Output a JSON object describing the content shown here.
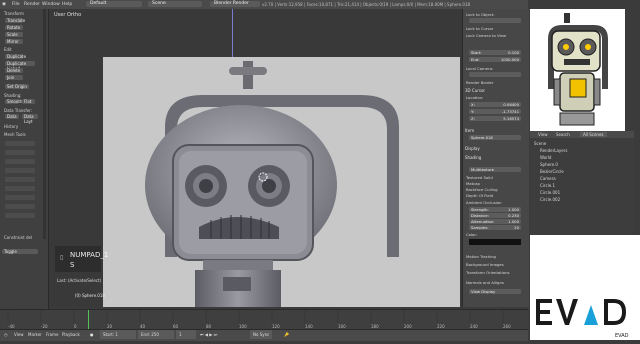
{
  "topbar": {
    "menu": [
      "File",
      "Render",
      "Window",
      "Help"
    ],
    "layout": "Default",
    "scene": "Scene",
    "engine": "Blender Render",
    "info": "v2.70 | Verts:12,958 | Faces:10,871 | Tris:21,414 | Objects:0/19 | Lamps:0/0 | Mem:18.00M | Sphere.018"
  },
  "toolshelf": {
    "transform_header": "Transform",
    "translate": "Translate",
    "rotate": "Rotate",
    "scale": "Scale",
    "mirror": "Mirror",
    "edit_header": "Edit",
    "duplicate": "Duplicate",
    "duplicate_linked": "Duplicate Linked",
    "delete": "Delete",
    "join": "Join",
    "set_origin": "Set Origin",
    "shading": "Shading:",
    "smooth": "Smooth",
    "flat": "Flat",
    "data_transfer": "Data Transfer:",
    "data": "Data",
    "data_layout": "Data Layt",
    "history": "History",
    "mesh_tools": "Mesh Tools",
    "last_op": "Constraint del",
    "toggle": "Toggle"
  },
  "viewport": {
    "view_label": "User Ortho",
    "numpad_label": "NUMPAD_1",
    "numpad_sub": "S",
    "last_op": "Last: (Activate/Select)",
    "object_name": "(0) Sphere.018",
    "header_mode": "Object Mode",
    "header_global": "Global"
  },
  "properties": {
    "lock_to_object": "Lock to Object:",
    "lock_to_cursor": "Lock to Cursor",
    "lock_camera": "Lock Camera to View",
    "clip_start_label": "Start:",
    "clip_start": "0.100",
    "clip_end_label": "End:",
    "clip_end": "1000.000",
    "local_camera": "Local Camera:",
    "render_border": "Render Border",
    "cursor_header": "3D Cursor",
    "location": "Location:",
    "x": "0.06400",
    "y": "-1.73741",
    "z": "5.16574",
    "item_header": "Item",
    "item_name": "Sphere.018",
    "display_header": "Display",
    "shading_header": "Shading",
    "multitexture": "Multitexture",
    "textured_solid": "Textured Solid",
    "matcap": "Matcap",
    "backface_culling": "Backface Culling",
    "depth_of_field": "Depth Of Field",
    "ambient_occlusion": "Ambient Occlusion",
    "strength_label": "Strength:",
    "strength": "1.000",
    "distance_label": "Distance:",
    "distance": "0.230",
    "attenuation_label": "Attenuation:",
    "attenuation": "1.000",
    "samples_label": "Samples:",
    "samples": "20",
    "color_label": "Color:",
    "motion_tracking": "Motion Tracking",
    "background_images": "Background Images",
    "transform_orientations": "Transform Orientations",
    "normals": "Normals and Alligns",
    "view_display": "View Display"
  },
  "outliner": {
    "tabs": [
      "View",
      "Search",
      "All Scenes"
    ],
    "items": [
      "Scene",
      "RenderLayers",
      "World",
      "Sphere.0",
      "BezierCircle",
      "Camera",
      "Circle.1",
      "Circle.001",
      "Circle.002"
    ]
  },
  "timeline": {
    "menus": [
      "View",
      "Marker",
      "Frame",
      "Playback"
    ],
    "start_label": "Start:",
    "start": "1",
    "end_label": "End:",
    "end": "250",
    "current": "1",
    "sync": "No Sync",
    "ruler": [
      "-40",
      "-20",
      "0",
      "20",
      "40",
      "60",
      "80",
      "100",
      "120",
      "140",
      "160",
      "180",
      "200",
      "220",
      "240",
      "260"
    ]
  },
  "brand": {
    "logo": "EVAD",
    "sub": "EVAD"
  },
  "colors": {
    "accent": "#5680c2",
    "panel": "#474747",
    "render_bg": "#c8c8c8",
    "logo_triangle": "#1aa0d8"
  }
}
